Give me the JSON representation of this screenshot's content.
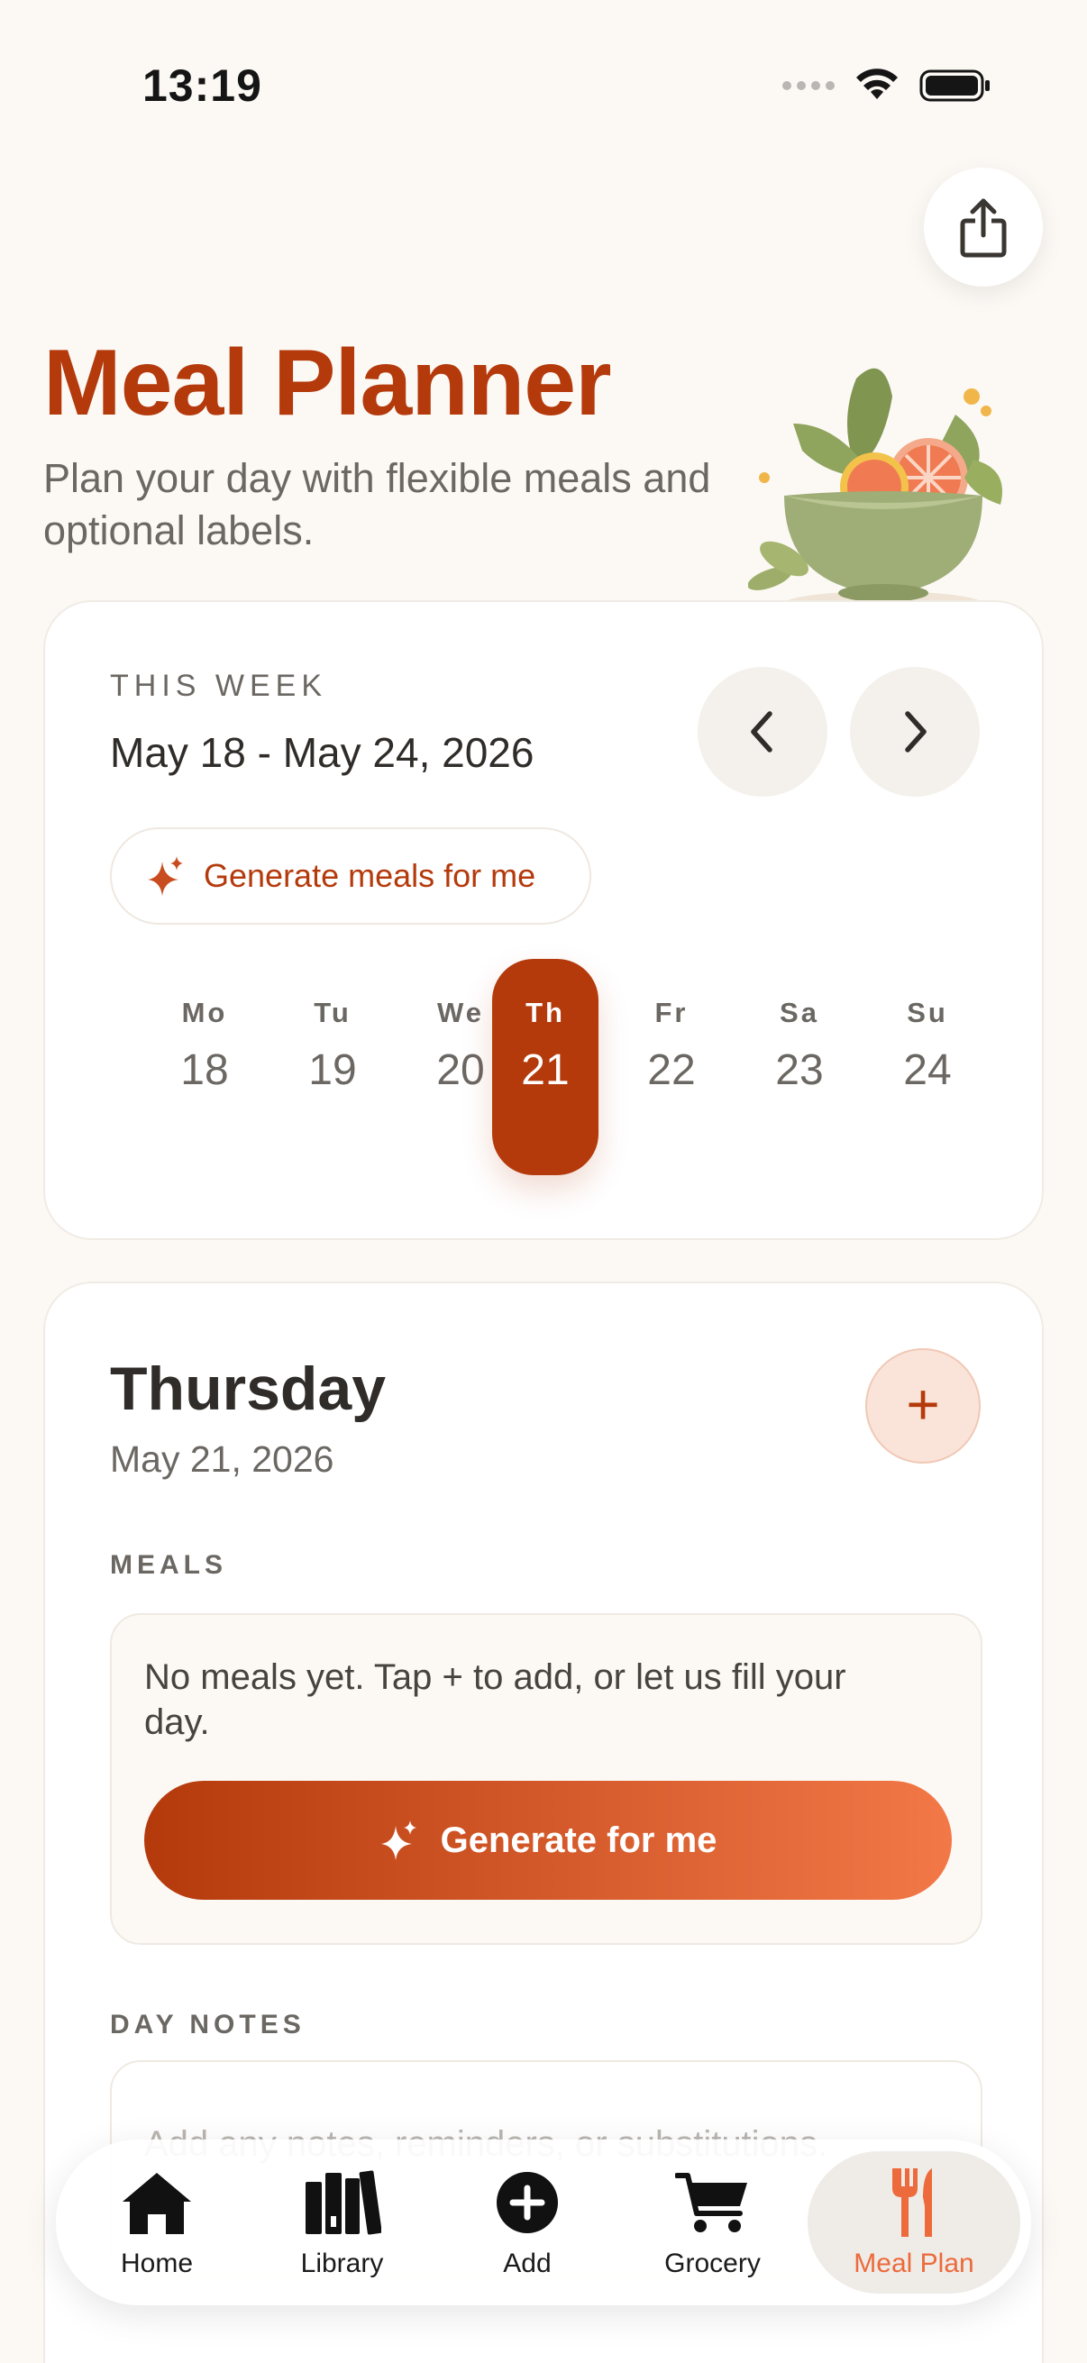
{
  "status_bar": {
    "time": "13:19"
  },
  "header": {
    "title": "Meal Planner",
    "subtitle": "Plan your day with flexible meals and optional labels."
  },
  "icons": {
    "share": "share-icon",
    "prev": "chevron-left-icon",
    "next": "chevron-right-icon",
    "sparkle": "sparkle-icon",
    "plus": "plus-icon",
    "illustration": "salad-bowl-illustration"
  },
  "week": {
    "label": "THIS WEEK",
    "range": "May 18 - May 24, 2026",
    "generate_label": "Generate meals for me",
    "days": [
      {
        "name": "Mo",
        "num": "18",
        "selected": false
      },
      {
        "name": "Tu",
        "num": "19",
        "selected": false
      },
      {
        "name": "We",
        "num": "20",
        "selected": false
      },
      {
        "name": "Th",
        "num": "21",
        "selected": true
      },
      {
        "name": "Fr",
        "num": "22",
        "selected": false
      },
      {
        "name": "Sa",
        "num": "23",
        "selected": false
      },
      {
        "name": "Su",
        "num": "24",
        "selected": false
      }
    ]
  },
  "day": {
    "title": "Thursday",
    "date": "May 21, 2026",
    "add_symbol": "+",
    "meals_label": "MEALS",
    "empty_text": "No meals yet. Tap + to add, or let us fill your day.",
    "generate_label": "Generate for me",
    "notes_label": "DAY NOTES",
    "notes_placeholder": "Add any notes, reminders, or substitutions."
  },
  "tabs": [
    {
      "label": "Home",
      "icon": "home-icon",
      "active": false
    },
    {
      "label": "Library",
      "icon": "library-icon",
      "active": false
    },
    {
      "label": "Add",
      "icon": "add-circle-icon",
      "active": false
    },
    {
      "label": "Grocery",
      "icon": "cart-icon",
      "active": false
    },
    {
      "label": "Meal Plan",
      "icon": "fork-knife-icon",
      "active": true
    }
  ],
  "colors": {
    "accent": "#b43a0c",
    "accent_light": "#f37848",
    "background": "#fcf9f5",
    "tab_active": "#ec6a3b"
  }
}
